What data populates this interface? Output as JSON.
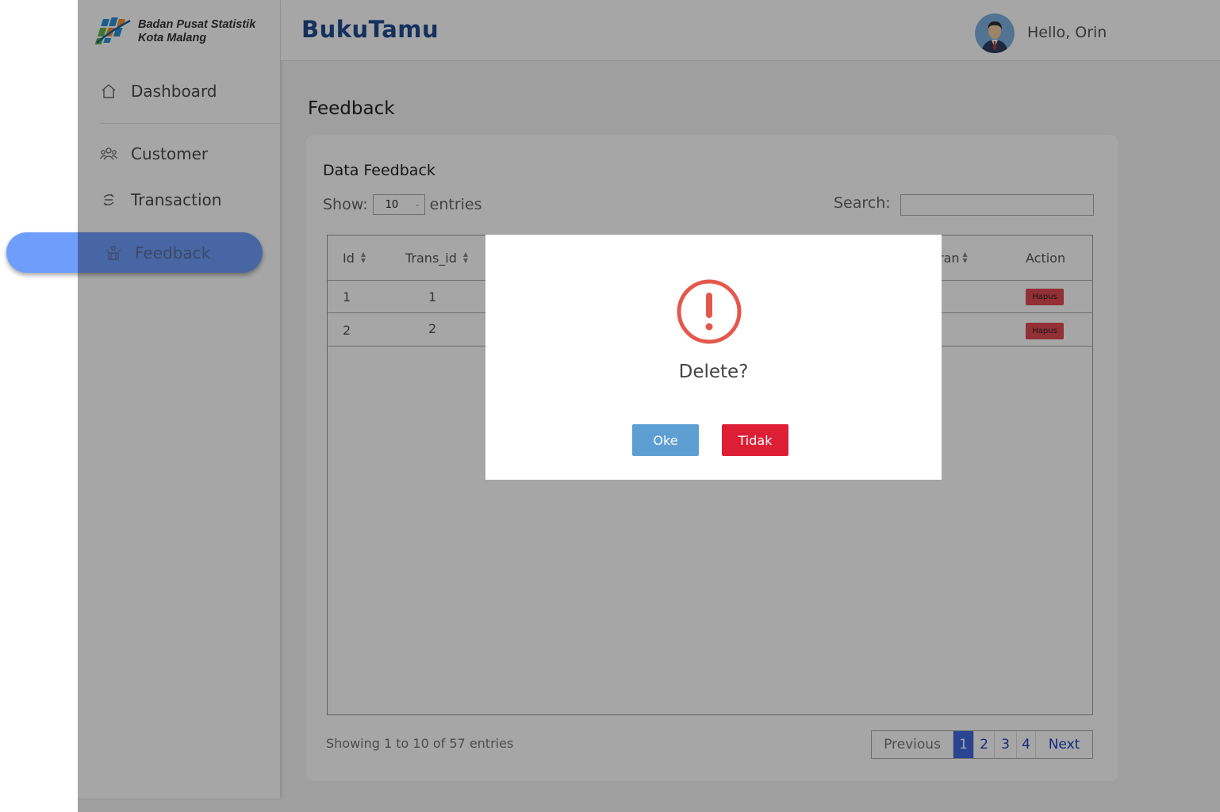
{
  "sidebar": {
    "logo_line1": "Badan Pusat Statistik",
    "logo_line2": "Kota Malang",
    "items": [
      {
        "label": "Dashboard",
        "icon": "home-icon"
      },
      {
        "label": "Customer",
        "icon": "users-icon"
      },
      {
        "label": "Transaction",
        "icon": "transaction-icon"
      },
      {
        "label": "Feedback",
        "icon": "feedback-icon"
      }
    ]
  },
  "header": {
    "brand": "BukuTamu",
    "greeting": "Hello, Orin"
  },
  "page": {
    "title": "Feedback",
    "card_title": "Data Feedback",
    "show_label": "Show:",
    "entries_value": "10",
    "entries_label": "entries",
    "search_label": "Search:",
    "search_value": ""
  },
  "table": {
    "headers": {
      "id": "Id",
      "trans_id": "Trans_id",
      "saran_partial": "ran",
      "action": "Action"
    },
    "rows": [
      {
        "id": "1",
        "trans_id": "1",
        "action": "Hapus"
      },
      {
        "id": "2",
        "trans_id": "2",
        "action": "Hapus"
      }
    ]
  },
  "footer": {
    "showing": "Showing 1 to 10 of 57 entries",
    "pager": {
      "previous": "Previous",
      "pages": [
        "1",
        "2",
        "3",
        "4"
      ],
      "next": "Next",
      "active_page": "1"
    }
  },
  "modal": {
    "message": "Delete?",
    "ok_label": "Oke",
    "cancel_label": "Tidak",
    "icon": "warning-icon",
    "icon_color": "#e4584c"
  },
  "colors": {
    "brand": "#1f4a8f",
    "highlight": "#6f9dfc",
    "ok_button": "#5d9fd3",
    "cancel_button": "#dc1f35",
    "delete_button": "#e24b54",
    "active_page": "#4169e1"
  }
}
